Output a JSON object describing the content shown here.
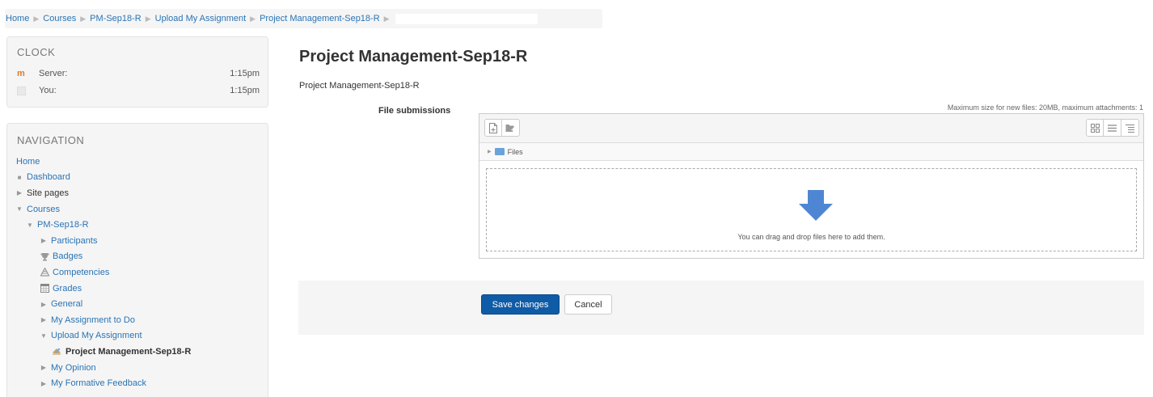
{
  "breadcrumb": [
    "Home",
    "Courses",
    "PM-Sep18-R",
    "Upload My Assignment",
    "Project Management-Sep18-R"
  ],
  "clock": {
    "title": "CLOCK",
    "rows": [
      {
        "label": "Server:",
        "value": "1:15pm",
        "icon": "moodle-m-icon"
      },
      {
        "label": "You:",
        "value": "1:15pm",
        "icon": "user-icon"
      }
    ]
  },
  "navigation": {
    "title": "NAVIGATION",
    "items": [
      {
        "label": "Home",
        "level": 0,
        "marker": "none"
      },
      {
        "label": "Dashboard",
        "level": 0,
        "marker": "bullet"
      },
      {
        "label": "Site pages",
        "level": 0,
        "marker": "collapsed"
      },
      {
        "label": "Courses",
        "level": 0,
        "marker": "expanded"
      },
      {
        "label": "PM-Sep18-R",
        "level": 1,
        "marker": "expanded"
      },
      {
        "label": "Participants",
        "level": 2,
        "marker": "collapsed"
      },
      {
        "label": "Badges",
        "level": 2,
        "marker": "trophy-icon"
      },
      {
        "label": "Competencies",
        "level": 2,
        "marker": "competency-icon"
      },
      {
        "label": "Grades",
        "level": 2,
        "marker": "grades-icon"
      },
      {
        "label": "General",
        "level": 2,
        "marker": "collapsed"
      },
      {
        "label": "My Assignment to Do",
        "level": 2,
        "marker": "collapsed"
      },
      {
        "label": "Upload My Assignment",
        "level": 2,
        "marker": "expanded"
      },
      {
        "label": "Project Management-Sep18-R",
        "level": 3,
        "marker": "assignment-icon",
        "current": true
      },
      {
        "label": "My Opinion",
        "level": 2,
        "marker": "collapsed"
      },
      {
        "label": "My Formative Feedback",
        "level": 2,
        "marker": "collapsed"
      }
    ]
  },
  "main": {
    "title": "Project Management-Sep18-R",
    "subtitle": "Project Management-Sep18-R",
    "file_submissions_label": "File submissions",
    "max_note": "Maximum size for new files: 20MB, maximum attachments: 1",
    "path_label": "Files",
    "drop_text": "You can drag and drop files here to add them."
  },
  "buttons": {
    "save": "Save changes",
    "cancel": "Cancel"
  },
  "colors": {
    "link": "#2a74b5",
    "primary": "#0f5ba6",
    "panel": "#f5f5f5",
    "arrow": "#4f86d4"
  }
}
